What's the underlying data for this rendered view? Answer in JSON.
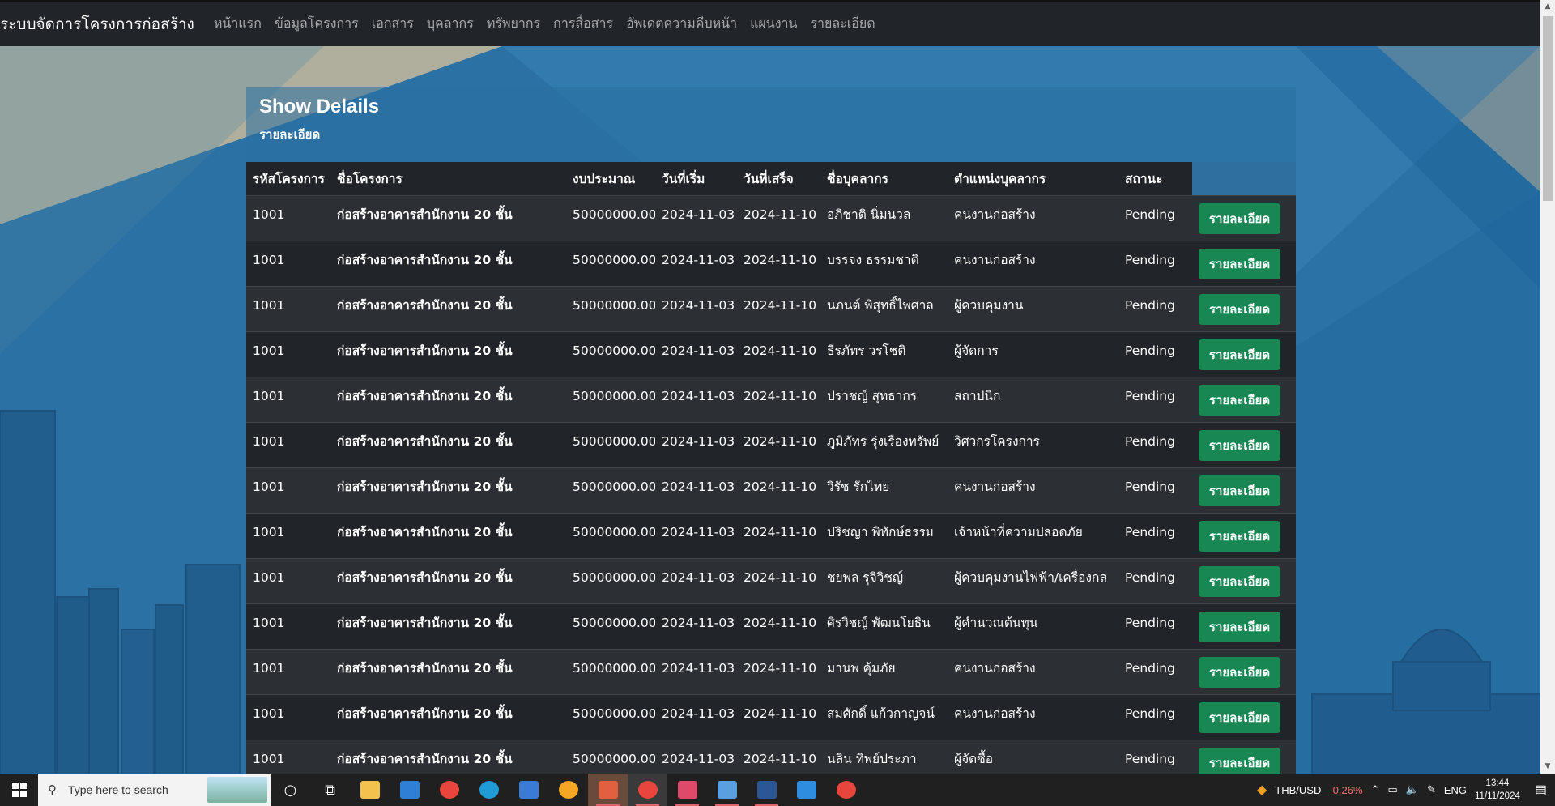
{
  "navbar": {
    "brand": "ระบบจัดการโครงการก่อสร้าง",
    "links": [
      "หน้าแรก",
      "ข้อมูลโครงการ",
      "เอกสาร",
      "บุคลากร",
      "ทรัพยากร",
      "การสื่อสาร",
      "อัพเดตความคืบหน้า",
      "แผนงาน",
      "รายละเอียด"
    ]
  },
  "card": {
    "title": "Show Delails",
    "subtitle": "รายละเอียด"
  },
  "table": {
    "headers": [
      "รหัสโครงการ",
      "ชื่อโครงการ",
      "งบประมาณ",
      "วันที่เริ่ม",
      "วันที่เสร็จ",
      "ชื่อบุคลากร",
      "ตำแหน่งบุคลากร",
      "สถานะ",
      ""
    ],
    "button_label": "รายละเอียด",
    "rows": [
      {
        "id": "1001",
        "name": "ก่อสร้างอาคารสำนักงาน 20 ชั้น",
        "budget": "50000000.00",
        "start": "2024-11-03",
        "end": "2024-11-10",
        "person": "อภิชาติ นิ่มนวล",
        "position": "คนงานก่อสร้าง",
        "status": "Pending"
      },
      {
        "id": "1001",
        "name": "ก่อสร้างอาคารสำนักงาน 20 ชั้น",
        "budget": "50000000.00",
        "start": "2024-11-03",
        "end": "2024-11-10",
        "person": "บรรจง ธรรมชาติ",
        "position": "คนงานก่อสร้าง",
        "status": "Pending"
      },
      {
        "id": "1001",
        "name": "ก่อสร้างอาคารสำนักงาน 20 ชั้น",
        "budget": "50000000.00",
        "start": "2024-11-03",
        "end": "2024-11-10",
        "person": "นภนต์ พิสุทธิ์ไพศาล",
        "position": "ผู้ควบคุมงาน",
        "status": "Pending"
      },
      {
        "id": "1001",
        "name": "ก่อสร้างอาคารสำนักงาน 20 ชั้น",
        "budget": "50000000.00",
        "start": "2024-11-03",
        "end": "2024-11-10",
        "person": "ธีรภัทร วรโชติ",
        "position": "ผู้จัดการ",
        "status": "Pending"
      },
      {
        "id": "1001",
        "name": "ก่อสร้างอาคารสำนักงาน 20 ชั้น",
        "budget": "50000000.00",
        "start": "2024-11-03",
        "end": "2024-11-10",
        "person": "ปราชญ์ สุทธากร",
        "position": "สถาปนิก",
        "status": "Pending"
      },
      {
        "id": "1001",
        "name": "ก่อสร้างอาคารสำนักงาน 20 ชั้น",
        "budget": "50000000.00",
        "start": "2024-11-03",
        "end": "2024-11-10",
        "person": "ภูมิภัทร รุ่งเรืองทรัพย์",
        "position": "วิศวกรโครงการ",
        "status": "Pending"
      },
      {
        "id": "1001",
        "name": "ก่อสร้างอาคารสำนักงาน 20 ชั้น",
        "budget": "50000000.00",
        "start": "2024-11-03",
        "end": "2024-11-10",
        "person": "วิรัช รักไทย",
        "position": "คนงานก่อสร้าง",
        "status": "Pending"
      },
      {
        "id": "1001",
        "name": "ก่อสร้างอาคารสำนักงาน 20 ชั้น",
        "budget": "50000000.00",
        "start": "2024-11-03",
        "end": "2024-11-10",
        "person": "ปริชญา พิทักษ์ธรรม",
        "position": "เจ้าหน้าที่ความปลอดภัย",
        "status": "Pending"
      },
      {
        "id": "1001",
        "name": "ก่อสร้างอาคารสำนักงาน 20 ชั้น",
        "budget": "50000000.00",
        "start": "2024-11-03",
        "end": "2024-11-10",
        "person": "ชยพล รุจิวิชญ์",
        "position": "ผู้ควบคุมงานไฟฟ้า/เครื่องกล",
        "status": "Pending"
      },
      {
        "id": "1001",
        "name": "ก่อสร้างอาคารสำนักงาน 20 ชั้น",
        "budget": "50000000.00",
        "start": "2024-11-03",
        "end": "2024-11-10",
        "person": "ศิรวิชญ์ พัฒนโยธิน",
        "position": "ผู้คำนวณต้นทุน",
        "status": "Pending"
      },
      {
        "id": "1001",
        "name": "ก่อสร้างอาคารสำนักงาน 20 ชั้น",
        "budget": "50000000.00",
        "start": "2024-11-03",
        "end": "2024-11-10",
        "person": "มานพ คุ้มภัย",
        "position": "คนงานก่อสร้าง",
        "status": "Pending"
      },
      {
        "id": "1001",
        "name": "ก่อสร้างอาคารสำนักงาน 20 ชั้น",
        "budget": "50000000.00",
        "start": "2024-11-03",
        "end": "2024-11-10",
        "person": "สมศักดิ์ แก้วกาญจน์",
        "position": "คนงานก่อสร้าง",
        "status": "Pending"
      },
      {
        "id": "1001",
        "name": "ก่อสร้างอาคารสำนักงาน 20 ชั้น",
        "budget": "50000000.00",
        "start": "2024-11-03",
        "end": "2024-11-10",
        "person": "นลิน ทิพย์ประภา",
        "position": "ผู้จัดซื้อ",
        "status": "Pending"
      }
    ]
  },
  "taskbar": {
    "search_placeholder": "Type here to search",
    "currency": "THB/USD",
    "currency_change": "-0.26%",
    "language": "ENG",
    "time": "13:44",
    "date": "11/11/2024",
    "apps": [
      "cortana-icon",
      "task-view-icon",
      "file-explorer-icon",
      "mail-icon",
      "chrome-icon",
      "edge-icon",
      "store-icon",
      "brave-icon",
      "game-icon",
      "chrome-active-icon",
      "app-icon",
      "photos-icon",
      "word-icon",
      "vscode-icon",
      "chrome-canary-icon"
    ]
  },
  "colors": {
    "navbar": "#212529",
    "button": "#198754",
    "background": "#2a73a6",
    "negative": "#ff6b6b"
  }
}
